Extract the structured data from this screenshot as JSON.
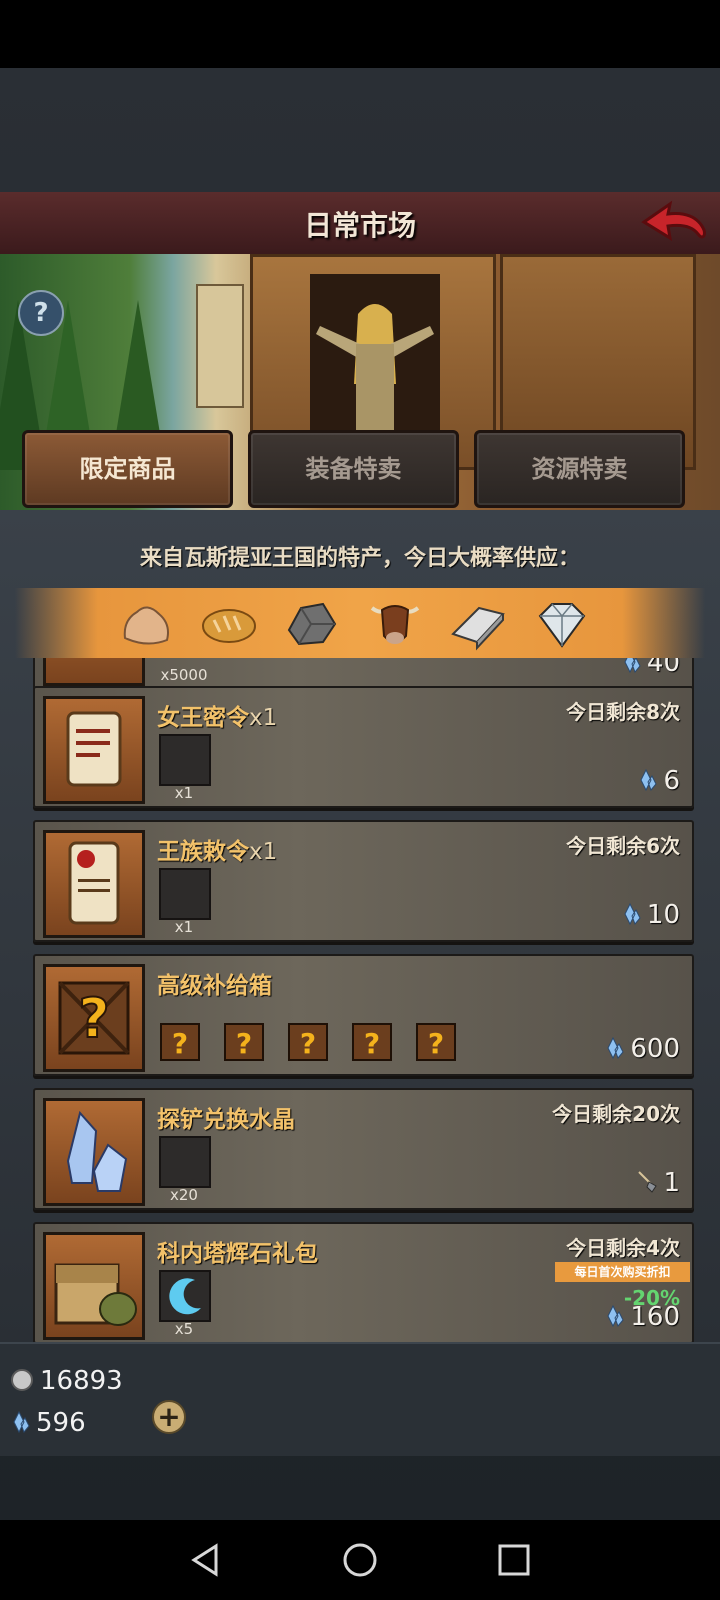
{
  "header": {
    "title": "日常市场"
  },
  "tabs": [
    {
      "label": "限定商品",
      "active": true
    },
    {
      "label": "装备特卖",
      "active": false
    },
    {
      "label": "资源特卖",
      "active": false
    }
  ],
  "supply": {
    "label": "来自瓦斯提亚王国的特产，今日大概率供应：",
    "icons": [
      "stone-icon",
      "bread-icon",
      "ore-icon",
      "cattle-icon",
      "iron-ingot-icon",
      "diamond-icon"
    ]
  },
  "items": [
    {
      "name": "",
      "qty": "",
      "remain": "",
      "slot_qty": "x5000",
      "price": "40"
    },
    {
      "name": "女王密令",
      "qty": "x1",
      "remain": "今日剩余8次",
      "slot_qty": "x1",
      "price": "6"
    },
    {
      "name": "王族敕令",
      "qty": "x1",
      "remain": "今日剩余6次",
      "slot_qty": "x1",
      "price": "10"
    },
    {
      "name": "高级补给箱",
      "qty": "",
      "remain": "",
      "slot_qty": "",
      "price": "600"
    },
    {
      "name": "探铲兑换水晶",
      "qty": "",
      "remain": "今日剩余20次",
      "slot_qty": "x20",
      "price": "1"
    },
    {
      "name": "科内塔辉石礼包",
      "qty": "",
      "remain": "今日剩余4次",
      "slot_qty": "x5",
      "price": "160",
      "discount_badge": "每日首次购买折扣",
      "discount_pct": "-20%"
    }
  ],
  "footer": {
    "silver": "16893",
    "crystal": "596"
  },
  "colors": {
    "accent": "#f0a448",
    "title_bar": "#4a2325",
    "item_name": "#f3c26a",
    "discount": "#64d470"
  }
}
